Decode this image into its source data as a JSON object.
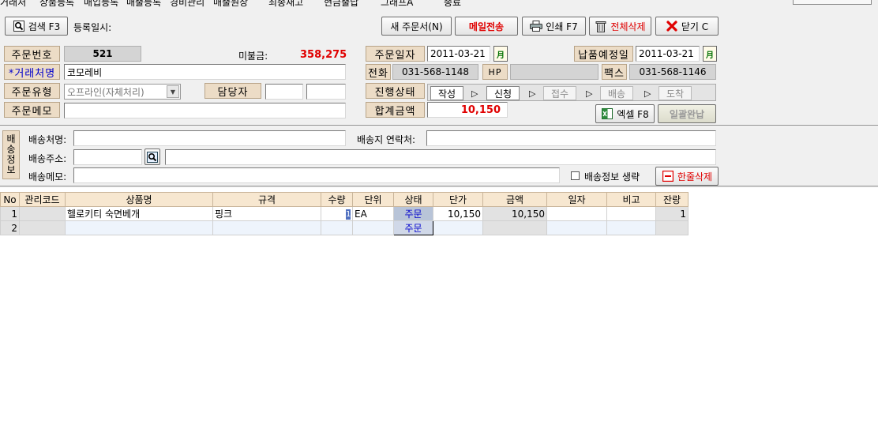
{
  "menu": {
    "items": [
      "거래처",
      "상품등록",
      "매입등록",
      "매출등록",
      "경비관리",
      "매출원장",
      "최종재고",
      "현금출납",
      "그래프A",
      "종료"
    ]
  },
  "toolbar": {
    "search_label": "검색 F3",
    "register_date_label": "등록일시:",
    "new_order_label": "새 주문서(N)",
    "email_send_label": "메일전송",
    "print_label": "인쇄 F7",
    "delete_all_label": "전체삭제",
    "close_label": "닫기 C"
  },
  "order": {
    "order_no_label": "주문번호",
    "order_no": "521",
    "unpaid_label": "미불금:",
    "unpaid_amount": "358,275",
    "order_date_label": "주문일자",
    "order_date": "2011-03-21",
    "delivery_date_label": "납품예정일",
    "delivery_date": "2011-03-21",
    "calendar_glyph": "月",
    "client_label": "*거래처명",
    "client_name": "코모레비",
    "phone_label": "전화",
    "phone": "031-568-1148",
    "hp_label": "HP",
    "hp": "",
    "fax_label": "팩스",
    "fax": "031-568-1146",
    "order_type_label": "주문유형",
    "order_type": "오프라인(자체처리)",
    "manager_label": "담당자",
    "manager_1": "",
    "manager_2": "",
    "progress_label": "진행상태",
    "steps": [
      "작성",
      "신청",
      "접수",
      "배송",
      "도착"
    ],
    "step_arrow": "▷",
    "memo_label": "주문메모",
    "memo": "",
    "total_label": "합계금액",
    "total_amount": "10,150",
    "excel_label": "엑셀 F8",
    "batch_complete_label": "일괄완납"
  },
  "shipping": {
    "tab_chars": [
      "배",
      "송",
      "정",
      "보"
    ],
    "recipient_label": "배송처명:",
    "recipient": "",
    "contact_label": "배송지 연락처:",
    "contact": "",
    "address_label": "배송주소:",
    "zipcode": "",
    "address": "",
    "memo_label": "배송메모:",
    "memo": "",
    "omit_label": "배송정보 생략",
    "delete_line_label": "한줄삭제"
  },
  "grid": {
    "columns": [
      "No",
      "관리코드",
      "상품명",
      "규격",
      "수량",
      "단위",
      "상태",
      "단가",
      "금액",
      "일자",
      "비고",
      "잔량"
    ],
    "rows": [
      [
        "1",
        "",
        "헬로키티 숙면베개",
        "핑크",
        "1",
        "EA",
        "주문",
        "10,150",
        "10,150",
        "",
        "",
        "1"
      ],
      [
        "2",
        "",
        "",
        "",
        "",
        "",
        "주문",
        "",
        "",
        "",
        "",
        ""
      ]
    ]
  },
  "colors": {
    "label_bg": "#ecdcc6",
    "alert_red": "#e00000",
    "link_blue": "#0000cc"
  }
}
